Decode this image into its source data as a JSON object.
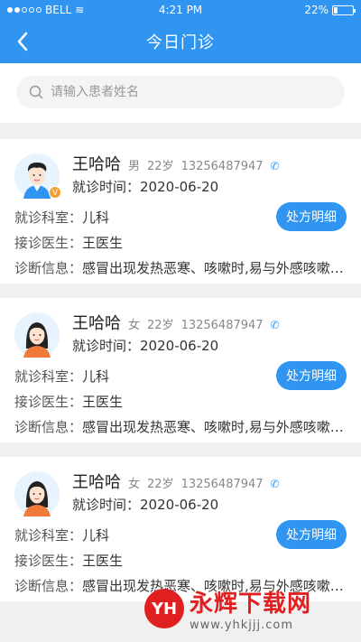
{
  "status_bar": {
    "carrier": "BELL",
    "time": "4:21 PM",
    "battery": "22%",
    "battery_level": 0.22
  },
  "nav": {
    "title": "今日门诊",
    "back_icon": "chevron-left-icon"
  },
  "search": {
    "placeholder": "请输入患者姓名"
  },
  "patients": [
    {
      "name": "王哈哈",
      "gender": "男",
      "age": "22岁",
      "phone": "13256487947",
      "visit_label": "就诊时间：",
      "visit_time": "2020-06-20",
      "dept_label": "就诊科室：",
      "dept": "儿科",
      "doctor_label": "接诊医生：",
      "doctor": "王医生",
      "diag_label": "诊断信息：",
      "diagnosis": "感冒出现发热恶寒、咳嗽时,易与外感咳嗽相...",
      "button": "处方明细",
      "badge": "V"
    },
    {
      "name": "王哈哈",
      "gender": "女",
      "age": "22岁",
      "phone": "13256487947",
      "visit_label": "就诊时间：",
      "visit_time": "2020-06-20",
      "dept_label": "就诊科室：",
      "dept": "儿科",
      "doctor_label": "接诊医生：",
      "doctor": "王医生",
      "diag_label": "诊断信息：",
      "diagnosis": "感冒出现发热恶寒、咳嗽时,易与外感咳嗽相...",
      "button": "处方明细"
    },
    {
      "name": "王哈哈",
      "gender": "女",
      "age": "22岁",
      "phone": "13256487947",
      "visit_label": "就诊时间：",
      "visit_time": "2020-06-20",
      "dept_label": "就诊科室：",
      "dept": "儿科",
      "doctor_label": "接诊医生：",
      "doctor": "王医生",
      "diag_label": "诊断信息：",
      "diagnosis": "感冒出现发热恶寒、咳嗽时,易与外感咳嗽相...",
      "button": "处方明细"
    }
  ],
  "watermark": {
    "logo": "YH",
    "title": "永辉下载网",
    "url": "www.yhkjjj.com"
  },
  "colors": {
    "primary": "#2f95f0",
    "watermark": "#e02020"
  }
}
